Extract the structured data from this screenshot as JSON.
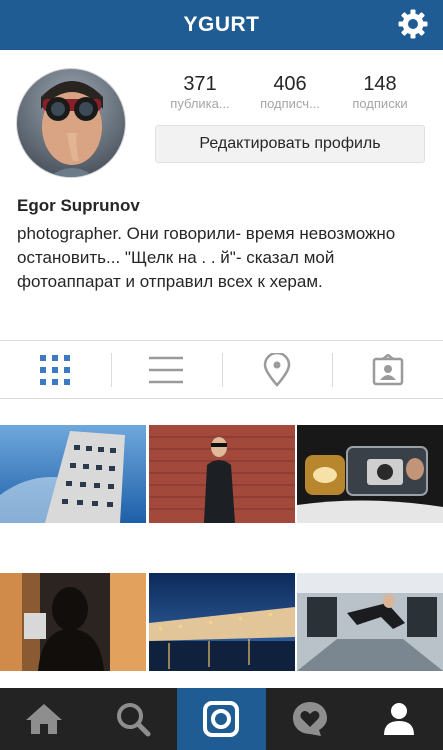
{
  "header": {
    "title": "YGURT"
  },
  "profile": {
    "stats": [
      {
        "number": "371",
        "label": "публика..."
      },
      {
        "number": "406",
        "label": "подписч..."
      },
      {
        "number": "148",
        "label": "подписки"
      }
    ],
    "edit_button": "Редактировать профиль",
    "name": "Egor Suprunov",
    "bio": "photographer. Они говорили- время невозможно остановить... \"Щелк на . . й\"- сказал мой фотоаппарат и отправил всех к херам."
  },
  "view_tabs": [
    "grid-icon",
    "list-icon",
    "location-pin-icon",
    "tagged-photos-icon"
  ],
  "tab_bar": {
    "items": [
      "home-icon",
      "search-icon",
      "camera-icon",
      "activity-heart-icon",
      "profile-icon"
    ],
    "active": "camera-icon"
  },
  "colors": {
    "header": "#1f5c93",
    "tab_bar": "#232323",
    "active_tab": "#1f5c93"
  }
}
